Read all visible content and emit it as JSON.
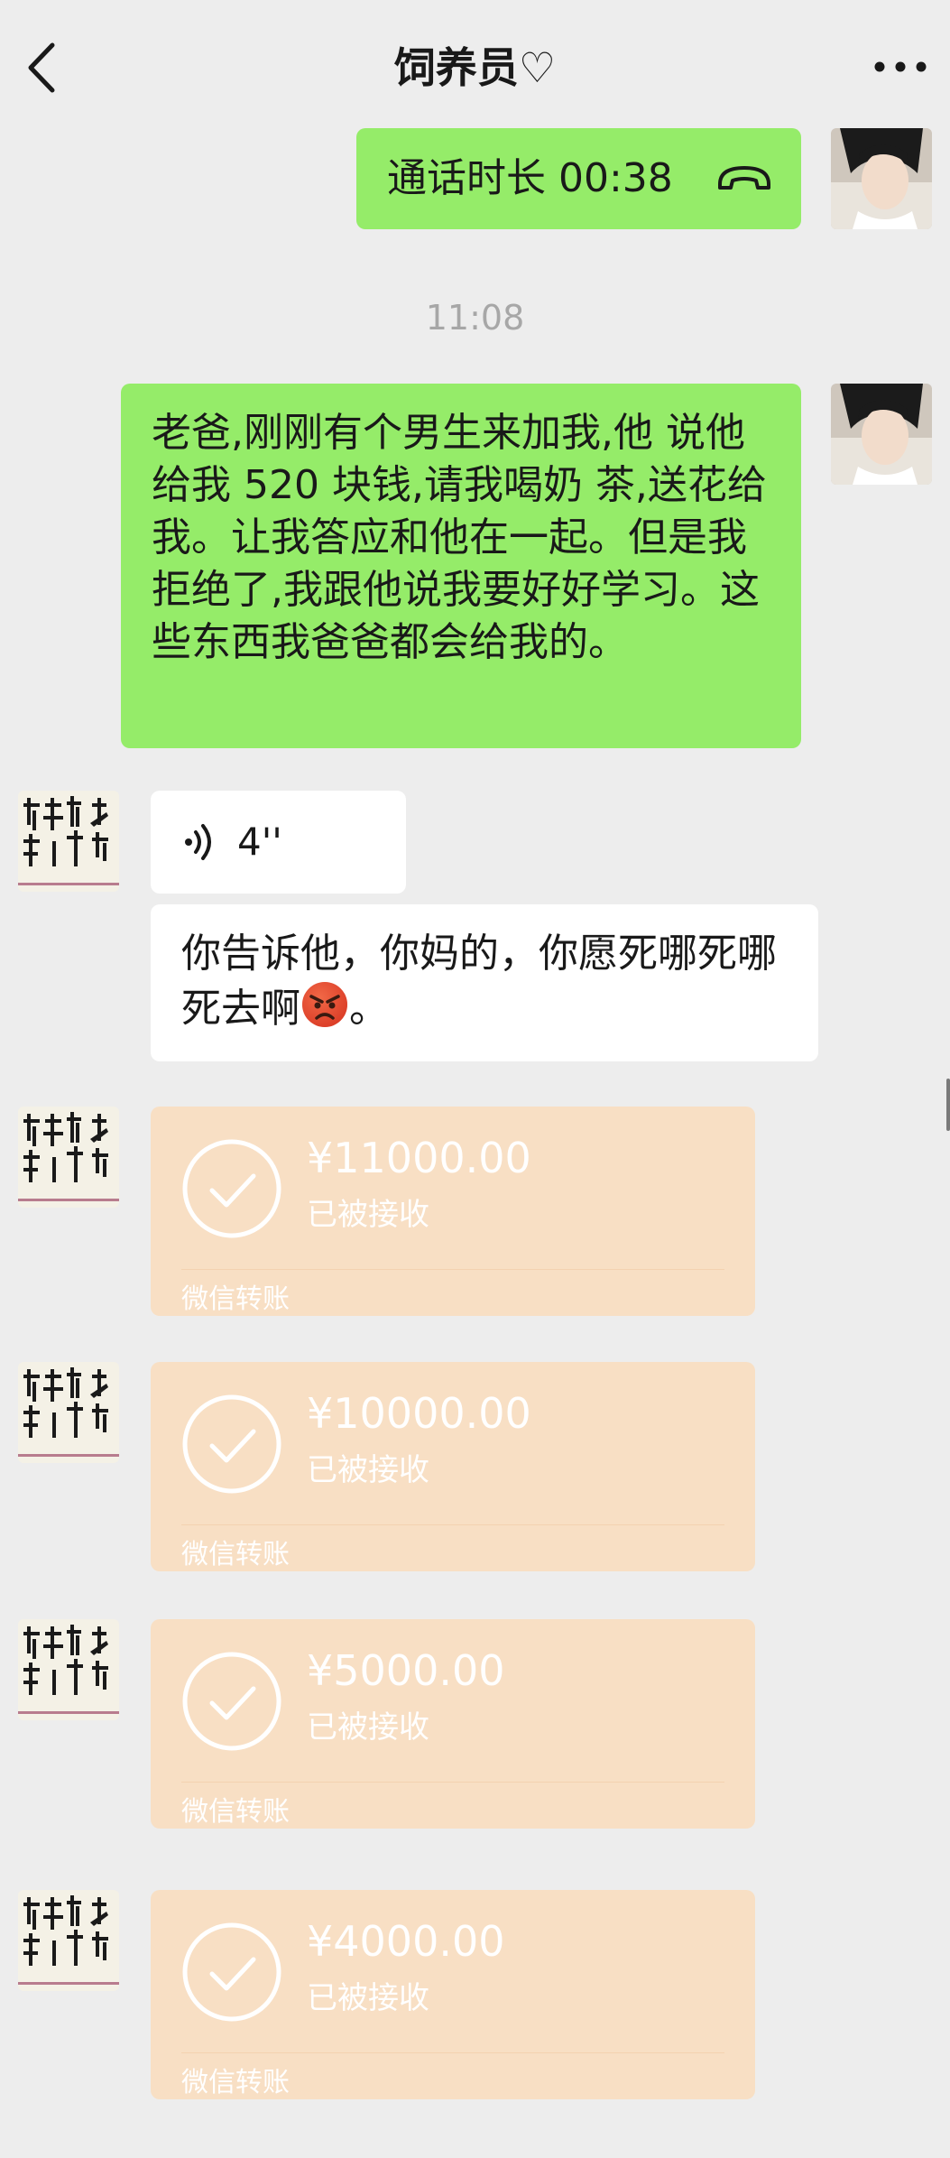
{
  "header": {
    "title": "饲养员♡"
  },
  "messages": {
    "call": {
      "label": "通话时长 00:38"
    },
    "timestamp": "11:08",
    "sent_text": "老爸,刚刚有个男生来加我,他 说他给我 520 块钱,请我喝奶 茶,送花给我。让我答应和他在一起。但是我拒绝了,我跟他说我要好好学习。这些东西我爸爸都会给我的。",
    "voice": {
      "duration": "4''"
    },
    "reply": {
      "text_before_emoji": "你告诉他，你妈的，你愿死哪死哪死去啊",
      "emoji": "angry-face-emoji",
      "text_after_emoji": "。"
    }
  },
  "transfers": [
    {
      "amount": "¥11000.00",
      "status": "已被接收",
      "footer": "微信转账"
    },
    {
      "amount": "¥10000.00",
      "status": "已被接收",
      "footer": "微信转账"
    },
    {
      "amount": "¥5000.00",
      "status": "已被接收",
      "footer": "微信转账"
    },
    {
      "amount": "¥4000.00",
      "status": "已被接收",
      "footer": "微信转账"
    }
  ],
  "colors": {
    "background": "#EDEDED",
    "sent_bubble": "#95EC69",
    "received_bubble": "#FFFFFF",
    "transfer_card": "#F8DFC4"
  }
}
